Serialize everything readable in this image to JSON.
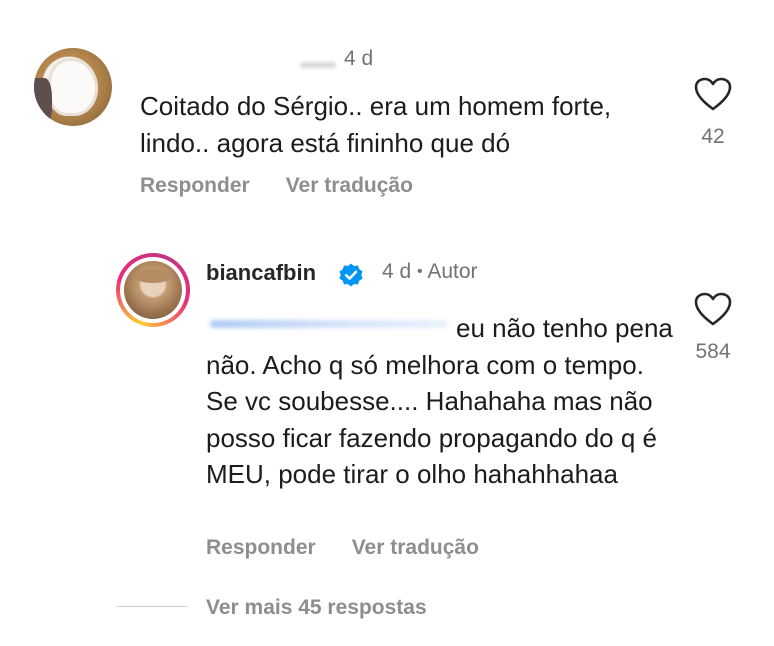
{
  "comment": {
    "time": "4 d",
    "text": "Coitado do Sérgio.. era um homem forte, lindo.. agora está fininho que dó",
    "reply_label": "Responder",
    "translate_label": "Ver tradução",
    "like_count": "42",
    "icons": {
      "like": "heart-outline-icon"
    }
  },
  "reply": {
    "username": "biancafbin",
    "time": "4 d",
    "separator": "•",
    "author_label": "Autor",
    "text": "eu não tenho pena não. Acho q só melhora com o tempo. Se vc soubesse.... Hahahaha mas não posso ficar fazendo propagando do q é MEU, pode tirar o olho hahahhahaa",
    "reply_label": "Responder",
    "translate_label": "Ver tradução",
    "like_count": "584",
    "icons": {
      "verified": "verified-badge-icon",
      "like": "heart-outline-icon"
    },
    "colors": {
      "verified": "#0095f6"
    }
  },
  "thread": {
    "more_replies_label": "Ver mais 45 respostas"
  }
}
